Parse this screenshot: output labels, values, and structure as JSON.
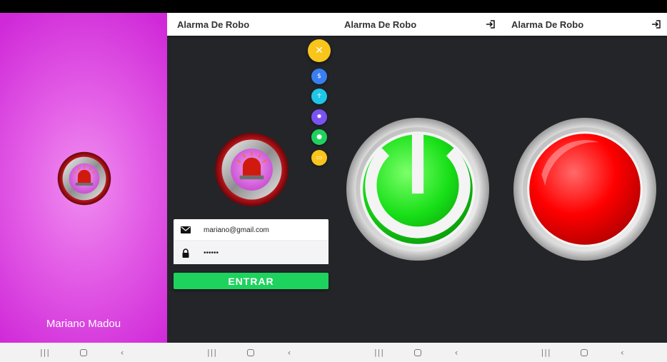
{
  "splash": {
    "author_name": "Mariano Madou"
  },
  "login": {
    "app_title": "Alarma De Robo",
    "fab_main_icon": "close-icon",
    "fab_main_color": "#f9c51b",
    "fab_items": [
      {
        "icon": "dollar-icon",
        "color": "#3a7ff0"
      },
      {
        "icon": "accessibility-icon",
        "color": "#1ec6e8"
      },
      {
        "icon": "settings-icon",
        "color": "#7a52f0"
      },
      {
        "icon": "lightbulb-icon",
        "color": "#1fd25e"
      },
      {
        "icon": "card-icon",
        "color": "#f9c51b"
      }
    ],
    "email_value": "mariano@gmail.com",
    "password_value": "••••••",
    "submit_label": "ENTRAR",
    "submit_color": "#1ed25e"
  },
  "armed": {
    "app_title": "Alarma De Robo",
    "state_color": "#18e018"
  },
  "triggered": {
    "app_title": "Alarma De Robo",
    "state_color": "#ff0000"
  },
  "colors": {
    "splash_accent": "#d02ad8",
    "dark_bg": "#232529"
  }
}
